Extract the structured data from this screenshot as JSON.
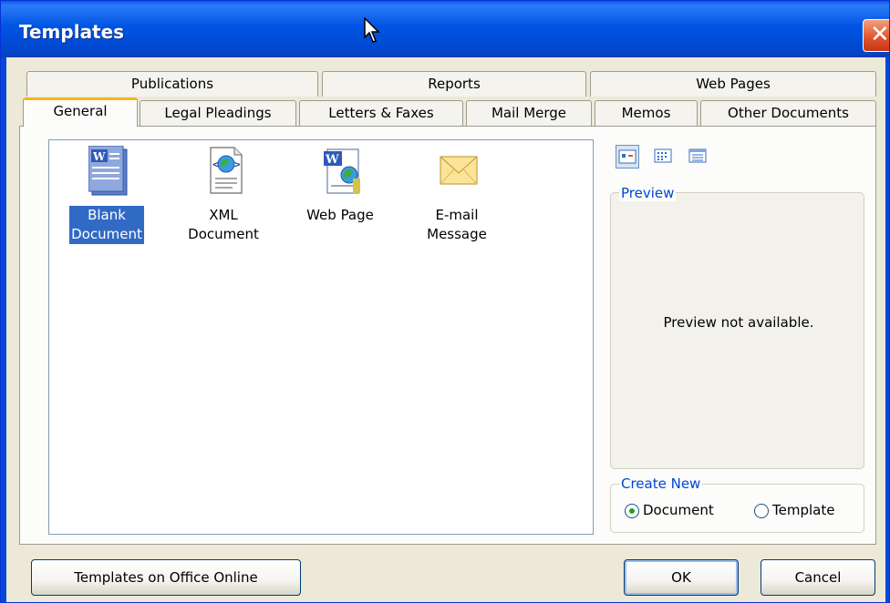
{
  "window": {
    "title": "Templates",
    "close_glyph": "✕"
  },
  "tabs_back": [
    "Publications",
    "Reports",
    "Web Pages"
  ],
  "tabs_front": [
    "General",
    "Legal Pleadings",
    "Letters & Faxes",
    "Mail Merge",
    "Memos",
    "Other Documents"
  ],
  "selected_tab": "General",
  "items": [
    {
      "label": "Blank Document",
      "line1": "Blank",
      "line2": "Document",
      "icon": "word-document-icon",
      "selected": true
    },
    {
      "label": "XML Document",
      "line1": "XML Document",
      "line2": "",
      "icon": "xml-document-icon",
      "selected": false
    },
    {
      "label": "Web Page",
      "line1": "Web Page",
      "line2": "",
      "icon": "web-page-icon",
      "selected": false
    },
    {
      "label": "E-mail Message",
      "line1": "E-mail",
      "line2": "Message",
      "icon": "envelope-icon",
      "selected": false
    }
  ],
  "view_buttons": [
    "large-icons-view-icon",
    "list-view-icon",
    "details-view-icon"
  ],
  "preview": {
    "label": "Preview",
    "text": "Preview not available."
  },
  "create_new": {
    "label": "Create New",
    "options": [
      "Document",
      "Template"
    ],
    "selected": "Document"
  },
  "buttons": {
    "online": "Templates on Office Online",
    "ok": "OK",
    "cancel": "Cancel"
  },
  "colors": {
    "titlebar": "#0054E3",
    "selection": "#316AC5",
    "tab_highlight": "#F7B51B",
    "group_label": "#0046D5",
    "radio_dot": "#21A121"
  }
}
